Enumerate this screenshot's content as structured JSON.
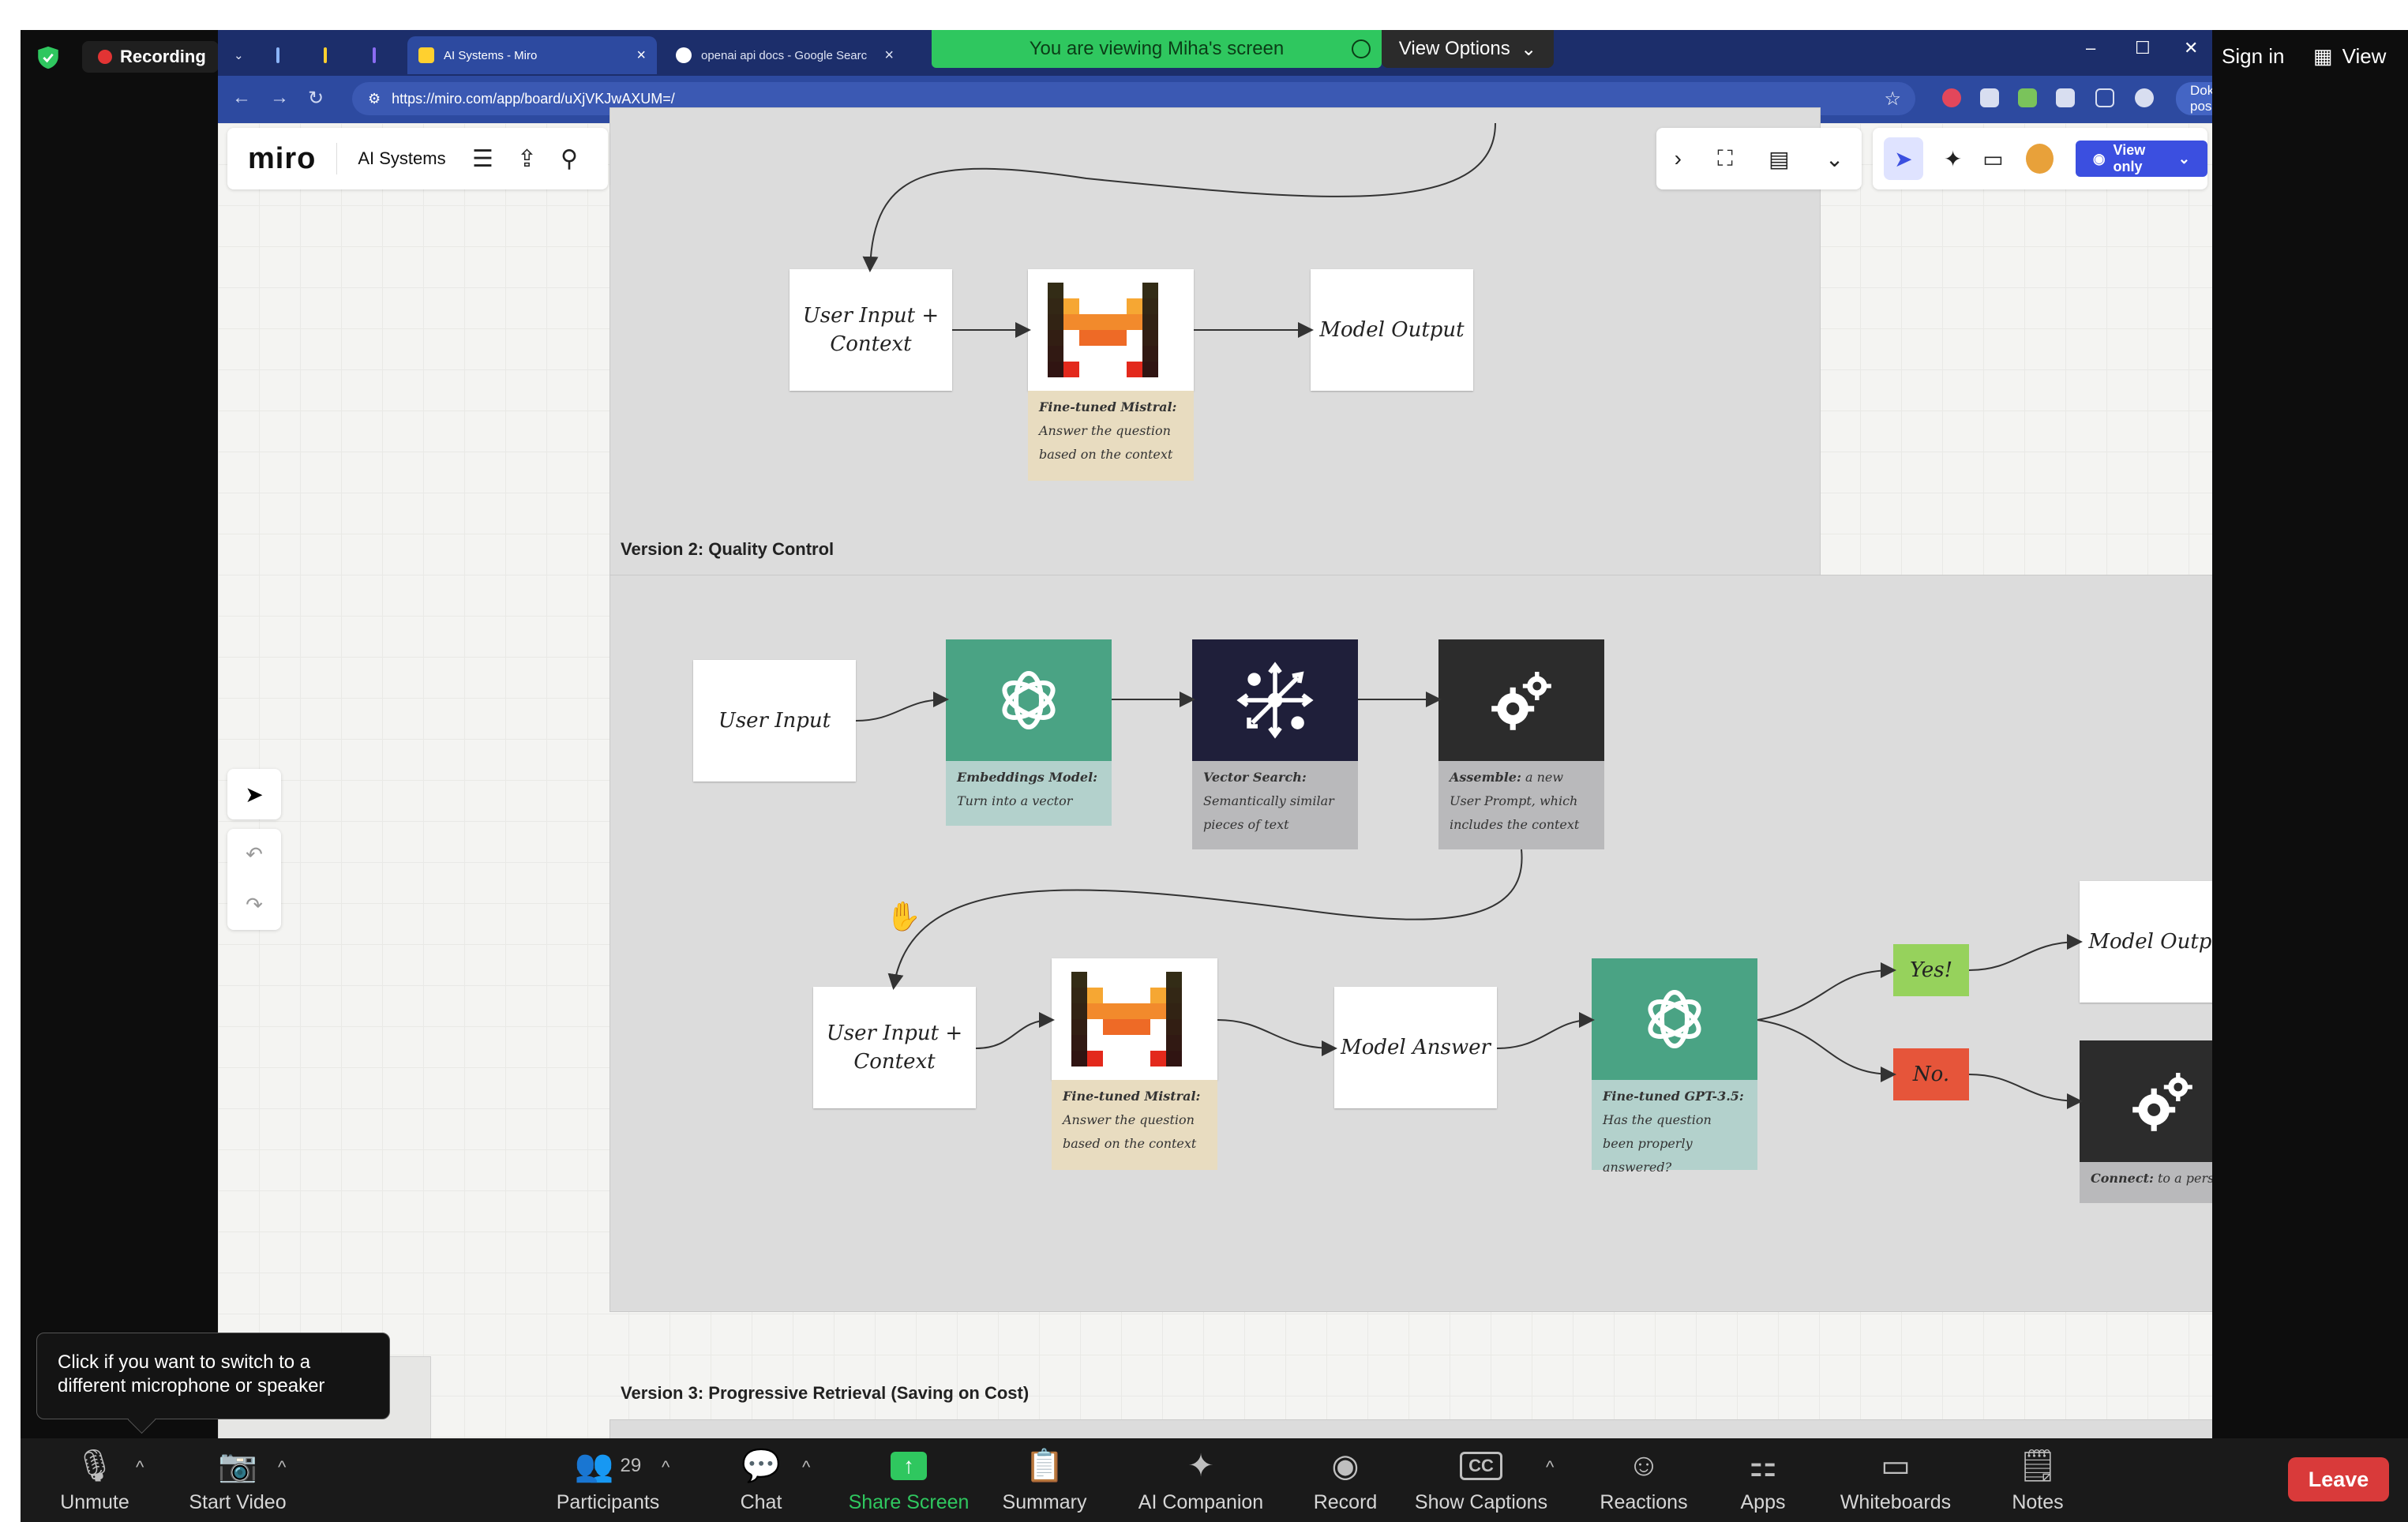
{
  "zoom": {
    "recording_label": "Recording",
    "viewing_banner": "You are viewing Miha's screen",
    "view_options": "View Options",
    "sign_in": "Sign in",
    "view": "View",
    "tooltip": "Click if you want to switch to a different microphone or speaker",
    "bottom": {
      "unmute": "Unmute",
      "start_video": "Start Video",
      "participants": "Participants",
      "participants_count": "29",
      "chat": "Chat",
      "share_screen": "Share Screen",
      "summary": "Summary",
      "ai_companion": "AI Companion",
      "record": "Record",
      "show_captions": "Show Captions",
      "reactions": "Reactions",
      "apps": "Apps",
      "whiteboards": "Whiteboards",
      "notes": "Notes",
      "leave": "Leave"
    }
  },
  "browser": {
    "tabs": [
      {
        "label": "AI Systems - Miro"
      },
      {
        "label": "openai api docs - Google Searc"
      }
    ],
    "url": "https://miro.com/app/board/uXjVKJwAXUM=/",
    "end_session": "Dokončaj posodobitev"
  },
  "miro": {
    "logo": "miro",
    "board_name": "AI Systems",
    "view_only": "View only"
  },
  "board": {
    "v1": {
      "user_input_context": "User Input + Context",
      "model_output": "Model Output",
      "mistral_note_title": "Fine-tuned Mistral:",
      "mistral_note_body": "Answer the question based on the context"
    },
    "v2": {
      "title": "Version 2: Quality Control",
      "user_input": "User Input",
      "embeddings_title": "Embeddings Model:",
      "embeddings_body": "Turn into a vector",
      "vector_title": "Vector Search:",
      "vector_body": "Semantically similar pieces of text",
      "assemble_title": "Assemble:",
      "assemble_body": "a new User Prompt, which includes the context",
      "user_input_context": "User Input + Context",
      "mistral_title": "Fine-tuned Mistral:",
      "mistral_body": "Answer the question based on the context",
      "model_answer": "Model Answer",
      "gpt_title": "Fine-tuned GPT-3.5:",
      "gpt_body": "Has the question been properly answered?",
      "yes": "Yes!",
      "no": "No.",
      "model_output": "Model Output",
      "connect_title": "Connect:",
      "connect_body": "to a person"
    },
    "v3": {
      "title": "Version 3: Progressive Retrieval (Saving on Cost)"
    }
  },
  "colors": {
    "openai_green": "#4aa384",
    "vector_dark": "#1f1f3a",
    "gear_dark": "#2c2c2c",
    "note_tan": "#e8dcc0",
    "note_teal": "#b3d1cc",
    "note_grey": "#b9b9bb",
    "yes_green": "#96d25c",
    "no_red": "#e6553a",
    "zoom_green": "#2fc75f",
    "leave_red": "#d93a3a"
  }
}
